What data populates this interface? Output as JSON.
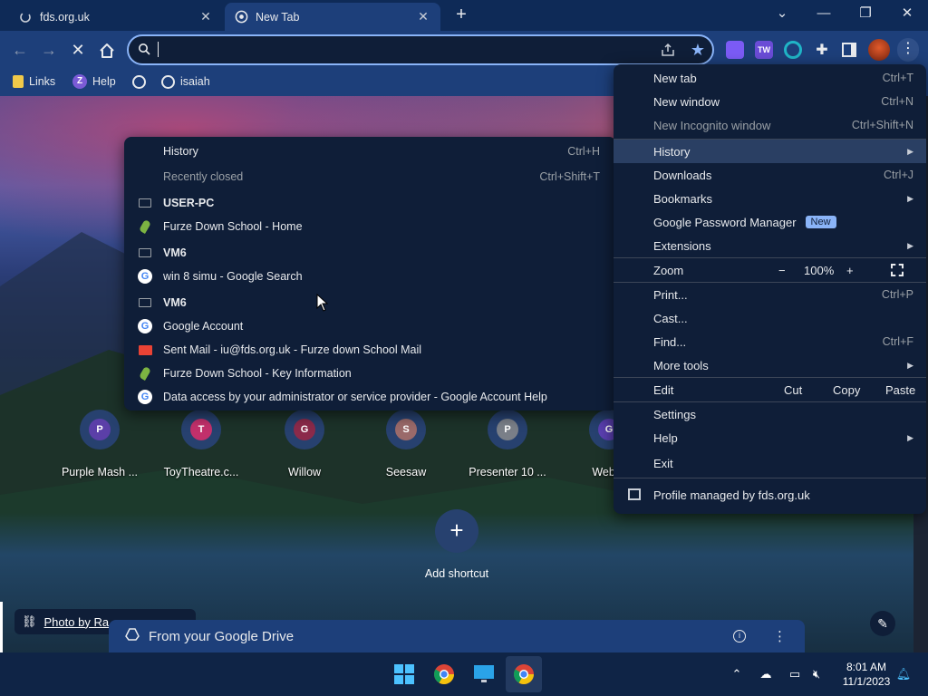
{
  "tabs": [
    {
      "title": "fds.org.uk",
      "active": false
    },
    {
      "title": "New Tab",
      "active": true
    }
  ],
  "window_controls": {
    "menu": "⌄",
    "minimize": "—",
    "restore": "❐",
    "close": "✕"
  },
  "omnibox": {
    "value": "",
    "placeholder": ""
  },
  "bookmarks": [
    {
      "label": "Links",
      "icon": "folder-icon"
    },
    {
      "label": "Help",
      "icon": "help-circle-icon"
    },
    {
      "label": "",
      "icon": "globe-icon"
    },
    {
      "label": "isaiah",
      "icon": "globe-icon"
    }
  ],
  "chrome_menu": {
    "items": [
      {
        "label": "New tab",
        "shortcut": "Ctrl+T"
      },
      {
        "label": "New window",
        "shortcut": "Ctrl+N"
      },
      {
        "label": "New Incognito window",
        "shortcut": "Ctrl+Shift+N",
        "disabled": true
      },
      {
        "label": "History",
        "submenu": true,
        "highlighted": true
      },
      {
        "label": "Downloads",
        "shortcut": "Ctrl+J"
      },
      {
        "label": "Bookmarks",
        "submenu": true
      },
      {
        "label": "Google Password Manager",
        "badge": "New"
      },
      {
        "label": "Extensions",
        "submenu": true
      },
      {
        "label": "Print...",
        "shortcut": "Ctrl+P"
      },
      {
        "label": "Cast..."
      },
      {
        "label": "Find...",
        "shortcut": "Ctrl+F"
      },
      {
        "label": "More tools",
        "submenu": true
      },
      {
        "label": "Settings"
      },
      {
        "label": "Help",
        "submenu": true
      },
      {
        "label": "Exit"
      }
    ],
    "zoom": {
      "label": "Zoom",
      "minus": "−",
      "value": "100%",
      "plus": "+"
    },
    "edit": {
      "label": "Edit",
      "cut": "Cut",
      "copy": "Copy",
      "paste": "Paste"
    },
    "managed": "Profile managed by fds.org.uk"
  },
  "history_menu": {
    "items": [
      {
        "label": "History",
        "shortcut": "Ctrl+H",
        "icon": "none",
        "style": "normal"
      },
      {
        "label": "Recently closed",
        "shortcut": "Ctrl+Shift+T",
        "icon": "none",
        "style": "dim"
      },
      {
        "label": "USER-PC",
        "icon": "device",
        "style": "bold"
      },
      {
        "label": "Furze Down School - Home",
        "icon": "leaf",
        "style": "normal"
      },
      {
        "label": "VM6",
        "icon": "device",
        "style": "bold"
      },
      {
        "label": "win 8 simu - Google Search",
        "icon": "google",
        "style": "normal"
      },
      {
        "label": "VM6",
        "icon": "device",
        "style": "bold"
      },
      {
        "label": "Google Account",
        "icon": "google",
        "style": "normal"
      },
      {
        "label": "Sent Mail - iu@fds.org.uk - Furze down School Mail",
        "icon": "mail",
        "style": "normal"
      },
      {
        "label": "Furze Down School - Key Information",
        "icon": "leaf",
        "style": "normal"
      },
      {
        "label": "Data access by your administrator or service provider - Google Account Help",
        "icon": "google",
        "style": "normal"
      }
    ]
  },
  "shortcuts": [
    {
      "label": "Purple Mash ...",
      "letter": "P",
      "color": "#5b3fa8"
    },
    {
      "label": "ToyTheatre.c...",
      "letter": "T",
      "color": "#c2306b"
    },
    {
      "label": "Willow",
      "letter": "G",
      "color": "#8b2a4a"
    },
    {
      "label": "Seesaw",
      "letter": "S",
      "color": "#9a6a6a"
    },
    {
      "label": "Presenter 10 ...",
      "letter": "P",
      "color": "#7a7f88"
    },
    {
      "label": "Web S",
      "letter": "G",
      "color": "#5a3fb0"
    }
  ],
  "add_shortcut": "Add shortcut",
  "photo_credit": "Photo by Ra",
  "drive_card": "From your Google Drive",
  "taskbar": {
    "time": "8:01 AM",
    "date": "11/1/2023"
  }
}
